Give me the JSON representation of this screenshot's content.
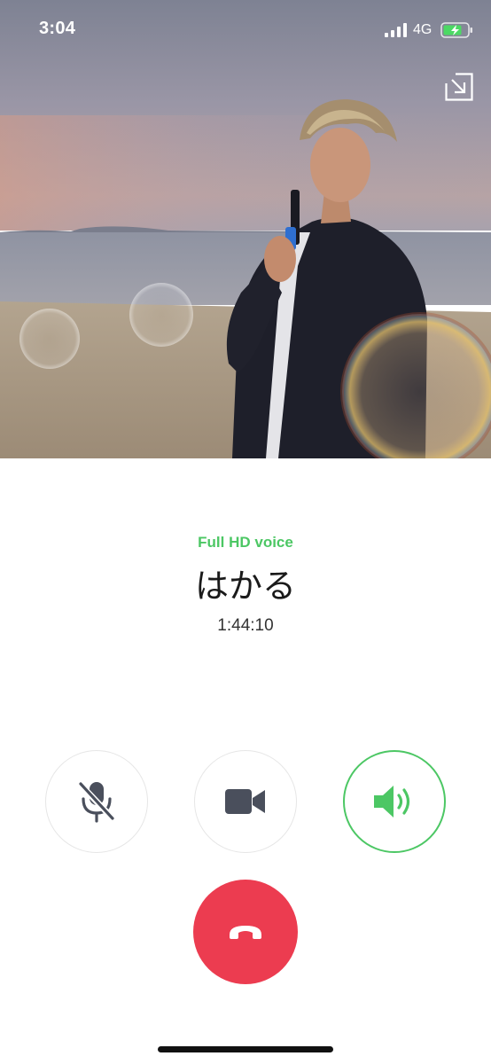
{
  "status_bar": {
    "time": "3:04",
    "network": "4G",
    "battery_icon": "battery-charging-icon",
    "signal_icon": "signal-bars-icon"
  },
  "photo": {
    "description_icon": "caller-photo"
  },
  "call": {
    "voice_quality": "Full HD voice",
    "caller_name": "はかる",
    "duration": "1:44:10"
  },
  "controls": {
    "mute_icon": "microphone-muted-icon",
    "video_icon": "video-camera-icon",
    "speaker_icon": "speaker-icon",
    "end_call_icon": "hang-up-icon",
    "minimize_icon": "minimize-icon"
  },
  "colors": {
    "accent_green": "#4cc764",
    "end_call_red": "#ec3c50",
    "icon_gray": "#4a4f5c"
  }
}
